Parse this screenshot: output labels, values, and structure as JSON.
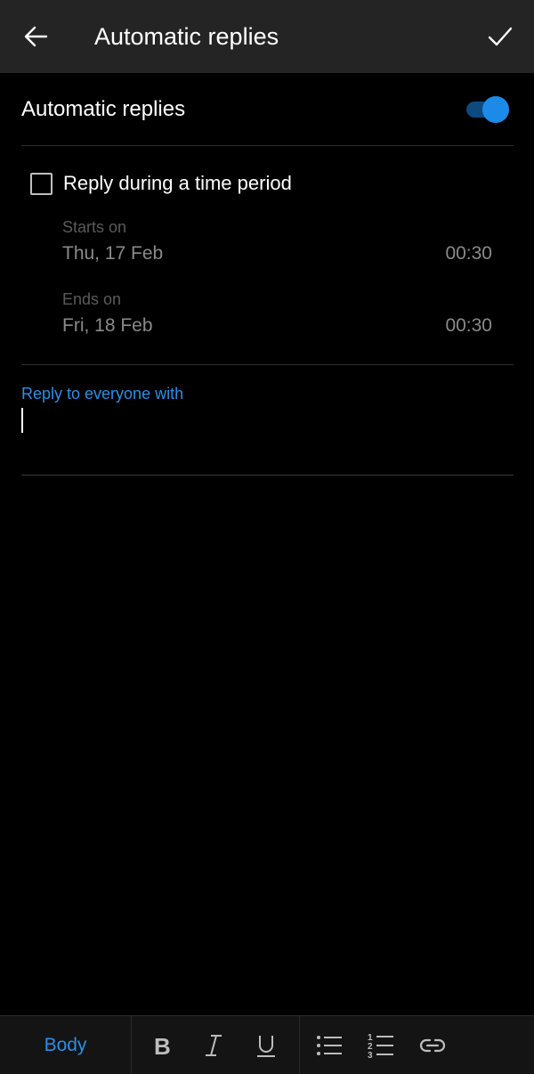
{
  "header": {
    "title": "Automatic replies",
    "back_icon": "arrow-left-icon",
    "confirm_icon": "checkmark-icon"
  },
  "auto_reply": {
    "label": "Automatic replies",
    "enabled": true,
    "accent_color": "#1c8be8"
  },
  "time_period": {
    "checkbox_label": "Reply during a time period",
    "checked": false,
    "start": {
      "caption": "Starts on",
      "date": "Thu, 17 Feb",
      "time": "00:30"
    },
    "end": {
      "caption": "Ends on",
      "date": "Fri, 18 Feb",
      "time": "00:30"
    }
  },
  "reply": {
    "label": "Reply to everyone with",
    "value": ""
  },
  "toolbar": {
    "style_label": "Body",
    "buttons": [
      "bold-icon",
      "italic-icon",
      "underline-icon",
      "bulleted-list-icon",
      "numbered-list-icon",
      "link-icon"
    ]
  }
}
